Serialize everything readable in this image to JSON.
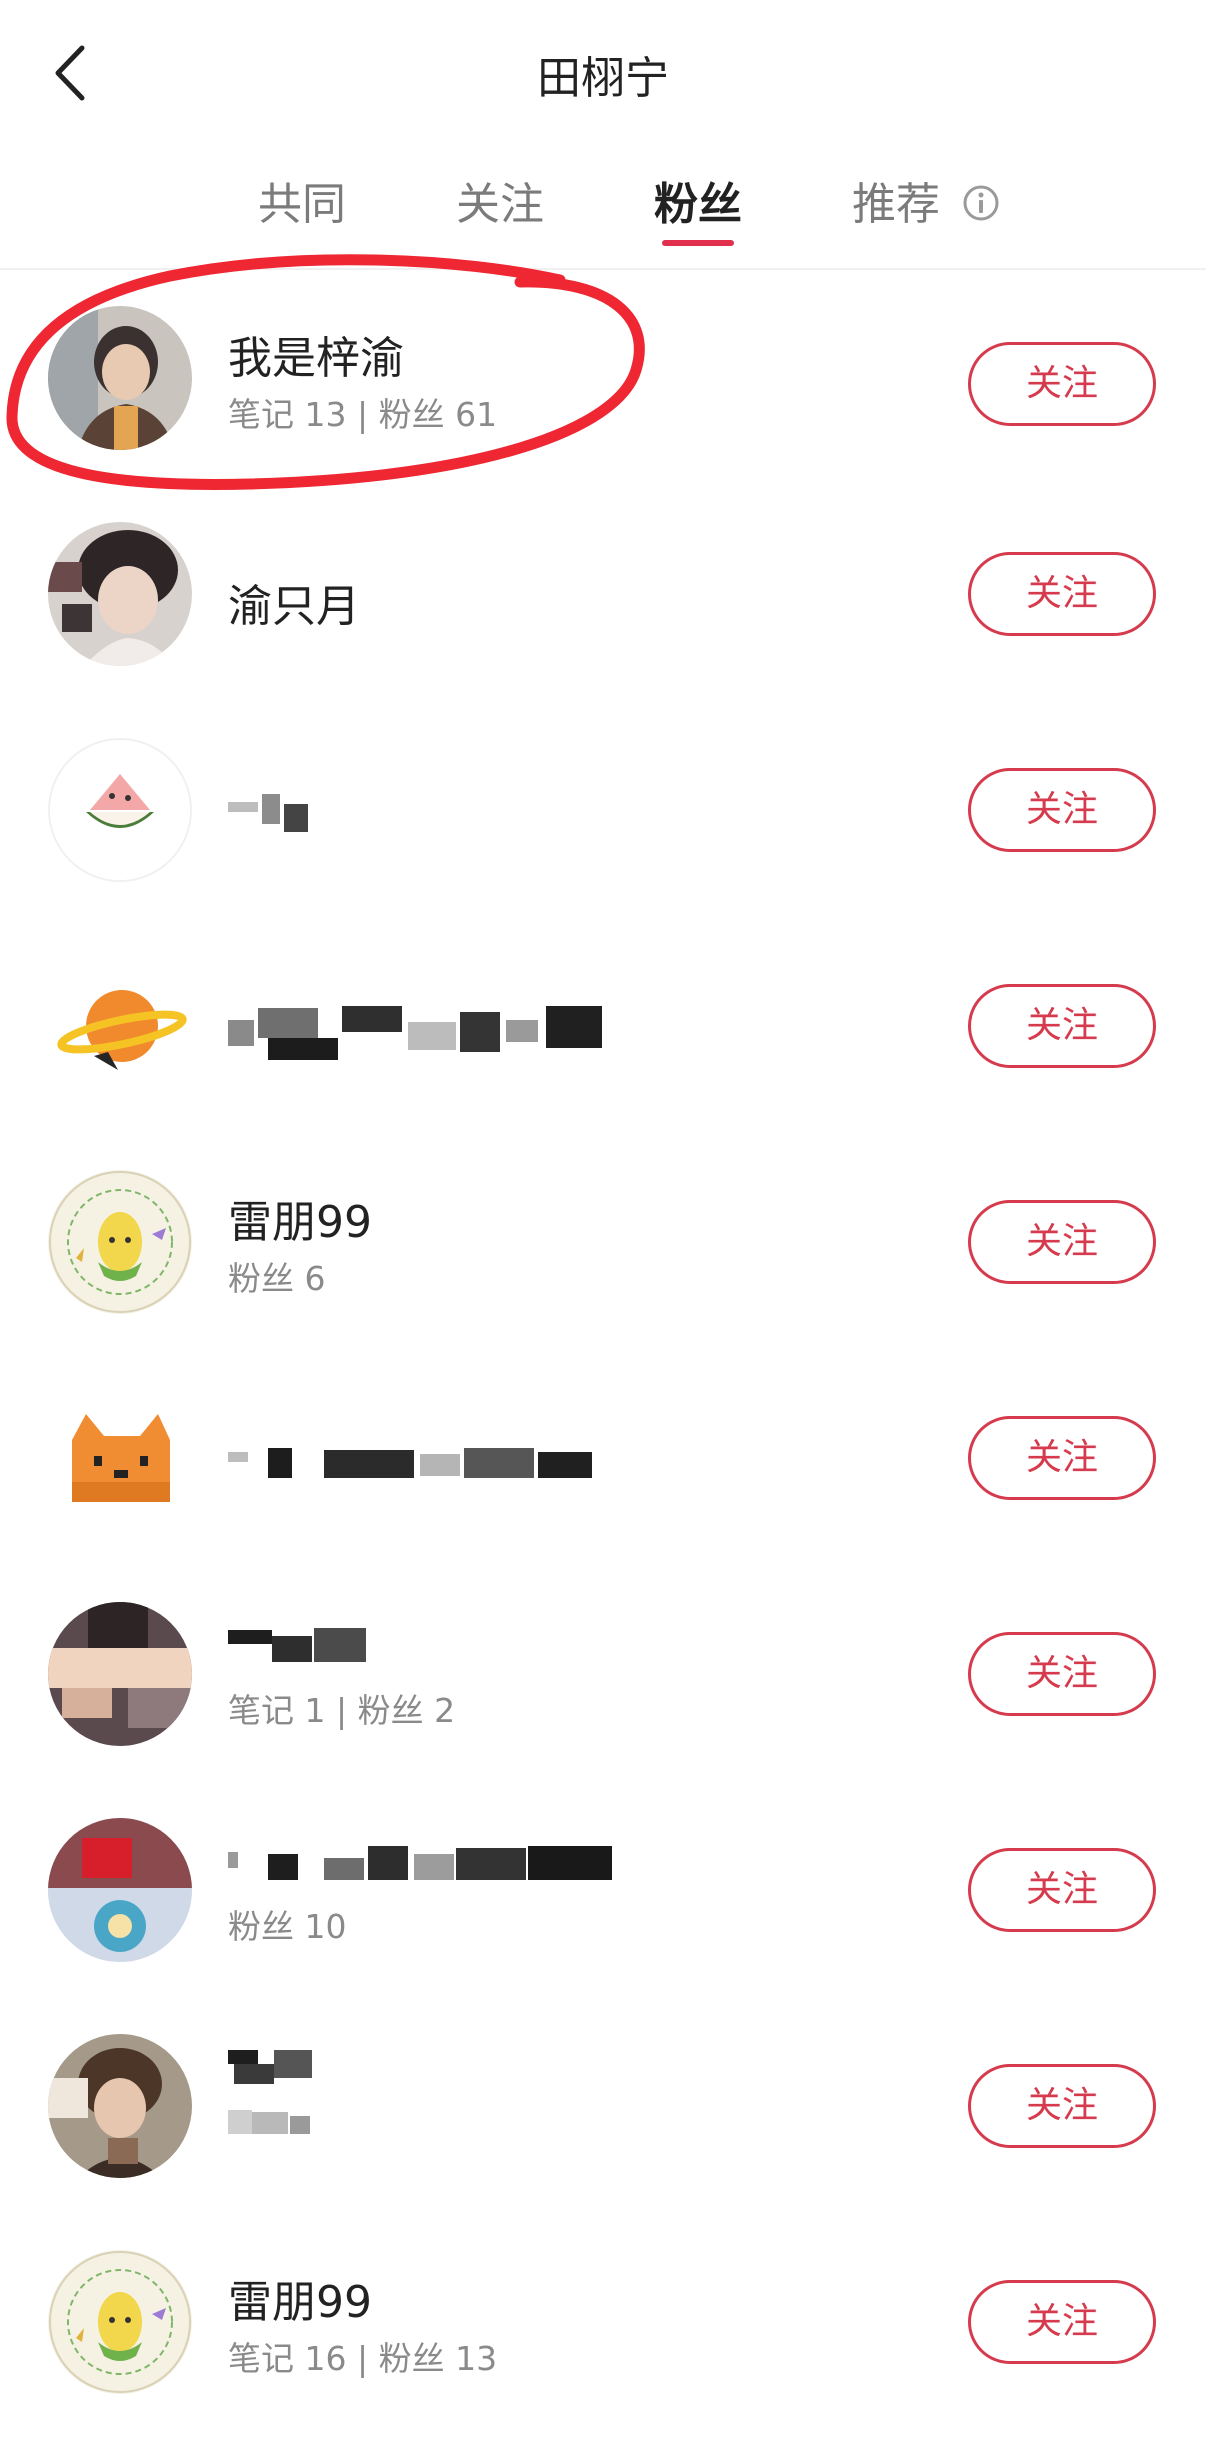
{
  "header": {
    "title": "田栩宁",
    "back_icon": "chevron-left-icon"
  },
  "tabs": [
    {
      "label": "共同",
      "active": false
    },
    {
      "label": "关注",
      "active": false
    },
    {
      "label": "粉丝",
      "active": true
    },
    {
      "label": "推荐",
      "active": false
    }
  ],
  "info_icon": "info-icon",
  "accent_color": "#d53b4d",
  "users": [
    {
      "name": "我是梓渝",
      "meta": "笔记 13 | 粉丝 61",
      "button": "关注",
      "highlighted": true
    },
    {
      "name": "渝只月",
      "meta": "",
      "button": "关注"
    },
    {
      "name": "",
      "meta": "",
      "button": "关注"
    },
    {
      "name": "",
      "meta": "",
      "button": "关注"
    },
    {
      "name": "雷朋99",
      "meta": "粉丝 6",
      "button": "关注"
    },
    {
      "name": "",
      "meta": "",
      "button": "关注"
    },
    {
      "name": "",
      "meta": "笔记 1 | 粉丝 2",
      "button": "关注"
    },
    {
      "name": "",
      "meta": "粉丝 10",
      "button": "关注"
    },
    {
      "name": "",
      "meta": "",
      "button": "关注"
    },
    {
      "name": "雷朋99",
      "meta": "笔记 16 | 粉丝 13",
      "button": "关注"
    }
  ]
}
